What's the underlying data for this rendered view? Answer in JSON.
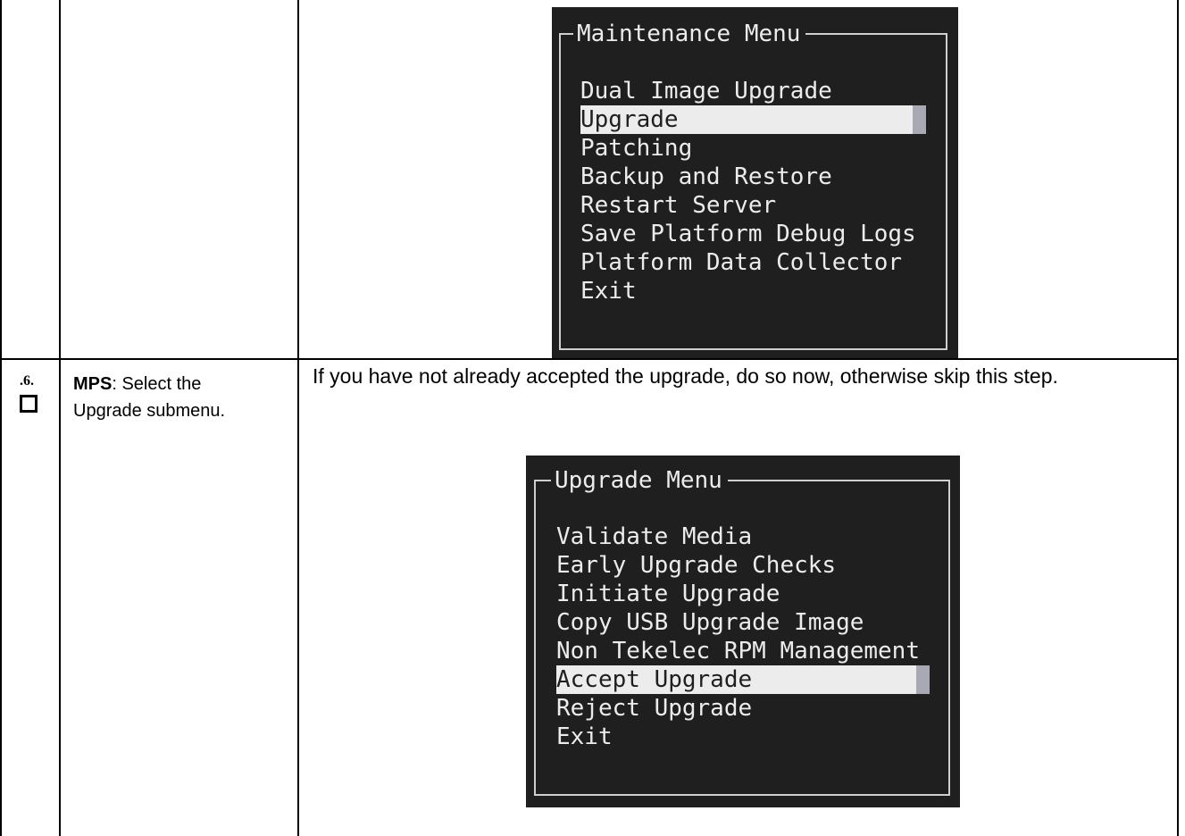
{
  "maintenance_menu": {
    "title": "Maintenance Menu",
    "items": [
      {
        "label": "Dual Image Upgrade",
        "selected": false
      },
      {
        "label": "Upgrade",
        "selected": true
      },
      {
        "label": "Patching",
        "selected": false
      },
      {
        "label": "Backup and Restore",
        "selected": false
      },
      {
        "label": "Restart Server",
        "selected": false
      },
      {
        "label": "Save Platform Debug Logs",
        "selected": false
      },
      {
        "label": "Platform Data Collector",
        "selected": false
      },
      {
        "label": "Exit",
        "selected": false
      }
    ]
  },
  "step": {
    "number": ".6.",
    "actor": "MPS",
    "description": ":  Select the Upgrade submenu.",
    "instruction": "If you have not already accepted the upgrade, do so now, otherwise skip this step."
  },
  "upgrade_menu": {
    "title": "Upgrade Menu",
    "items": [
      {
        "label": "Validate Media",
        "selected": false
      },
      {
        "label": "Early Upgrade Checks",
        "selected": false
      },
      {
        "label": "Initiate Upgrade",
        "selected": false
      },
      {
        "label": "Copy USB Upgrade Image",
        "selected": false
      },
      {
        "label": "Non Tekelec RPM Management",
        "selected": false
      },
      {
        "label": "Accept Upgrade",
        "selected": true
      },
      {
        "label": "Reject Upgrade",
        "selected": false
      },
      {
        "label": "Exit",
        "selected": false
      }
    ]
  }
}
